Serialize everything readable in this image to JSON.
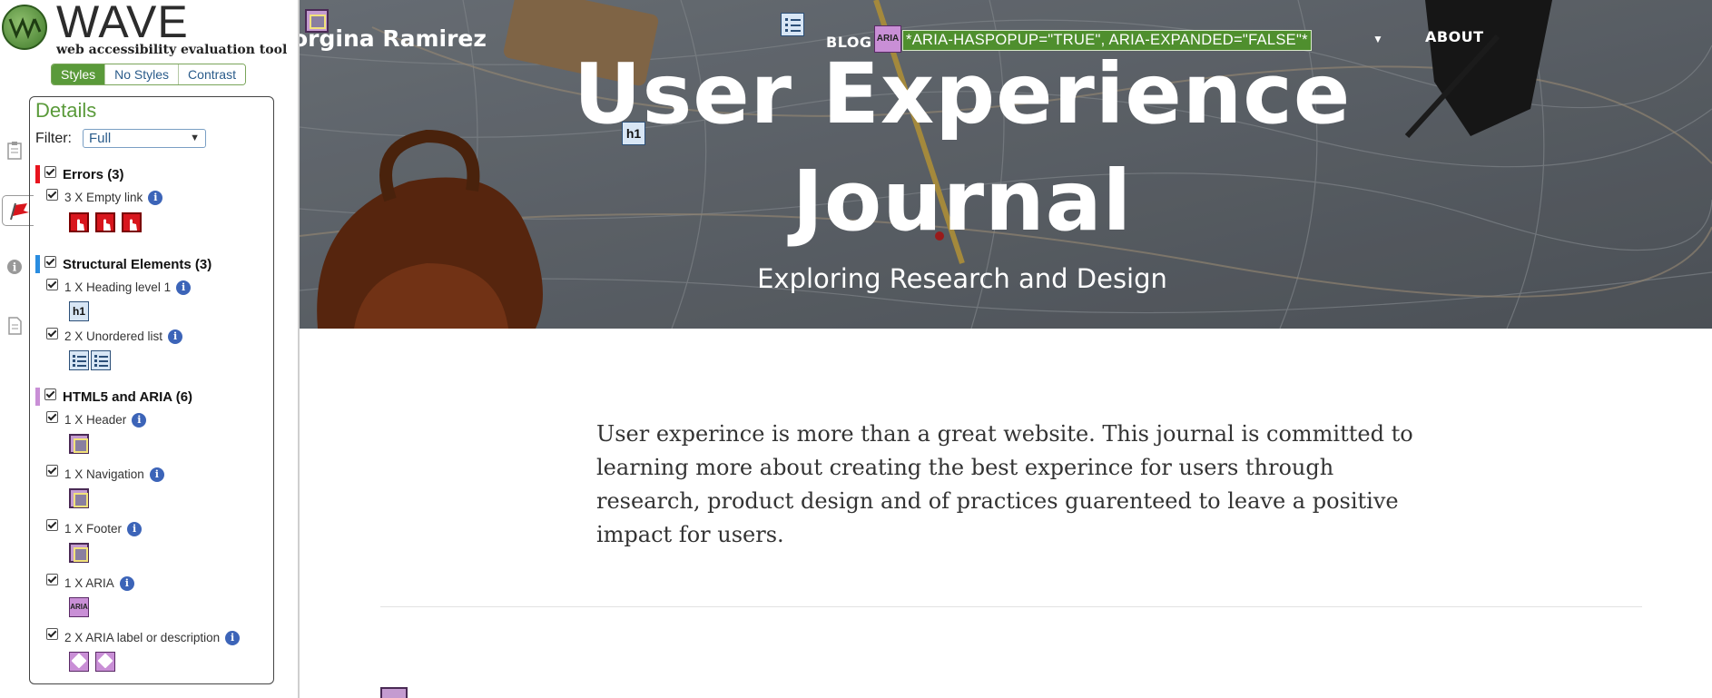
{
  "wave": {
    "logo_text": "WAVE",
    "logo_subtitle": "web accessibility evaluation tool",
    "view_toggle": [
      "Styles",
      "No Styles",
      "Contrast"
    ],
    "details_title": "Details",
    "filter_label": "Filter:",
    "filter_value": "Full",
    "categories": [
      {
        "title": "Errors (3)",
        "color": "#e8141e",
        "items": [
          {
            "label": "3 X Empty link",
            "icon": "empty-link-error-icon",
            "count": 3
          }
        ]
      },
      {
        "title": "Structural Elements (3)",
        "color": "#2a8de0",
        "items": [
          {
            "label": "1 X Heading level 1",
            "icon": "heading-level-1-icon",
            "icon_text": "h1",
            "count": 1
          },
          {
            "label": "2 X Unordered list",
            "icon": "unordered-list-icon",
            "count": 2
          }
        ]
      },
      {
        "title": "HTML5 and ARIA (6)",
        "color": "#c98fd6",
        "items": [
          {
            "label": "1 X Header",
            "icon": "header-icon",
            "count": 1
          },
          {
            "label": "1 X Navigation",
            "icon": "navigation-icon",
            "count": 1
          },
          {
            "label": "1 X Footer",
            "icon": "footer-icon",
            "count": 1
          },
          {
            "label": "1 X ARIA",
            "icon": "aria-icon",
            "icon_text": "ARIA",
            "count": 1
          },
          {
            "label": "2 X ARIA label or description",
            "icon": "aria-label-icon",
            "count": 2
          }
        ]
      }
    ]
  },
  "site": {
    "nav_name": "orgina Ramirez",
    "nav_links": [
      "BLOG",
      "ABOUT"
    ],
    "aria_badge": "ARIA",
    "aria_note": "*ARIA-HASPOPUP=\"TRUE\", ARIA-EXPANDED=\"FALSE\"*",
    "h1_badge": "h1",
    "hero_title_line1": "User Experience",
    "hero_title_line2": "Journal",
    "hero_subtitle": "Exploring Research and Design",
    "intro_text": "User experince is more than a great website. This journal is committed to learning more about creating the best experince for users through research, product design and of practices guarenteed to leave a positive impact for users."
  },
  "colors": {
    "wave_green": "#5a9a3a",
    "error_red": "#e8141e",
    "structure_blue": "#2a8de0",
    "aria_purple": "#c98fd6"
  }
}
